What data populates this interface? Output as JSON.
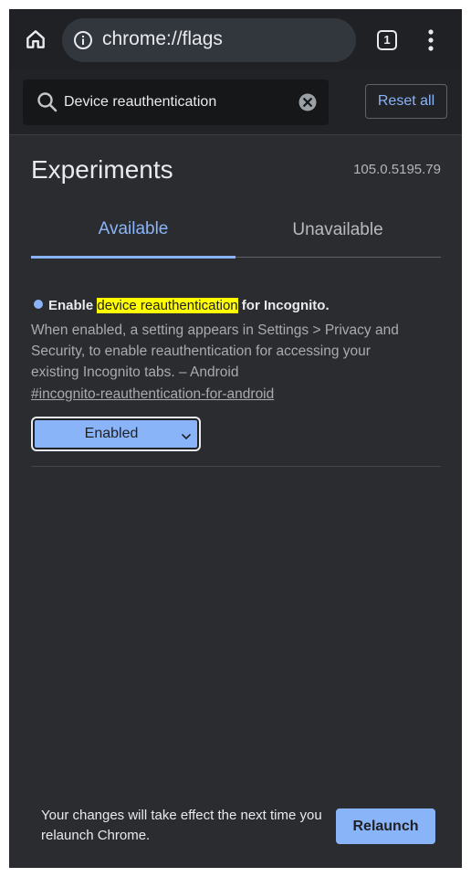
{
  "toolbar": {
    "home_icon": "home-icon",
    "info_icon": "info-icon",
    "url": "chrome://flags",
    "tab_count": "1",
    "menu_icon": "more-vert-icon"
  },
  "search": {
    "query": "Device reauthentication",
    "search_icon": "search-icon",
    "clear_icon": "clear-icon",
    "reset_label": "Reset all"
  },
  "header": {
    "title": "Experiments",
    "version": "105.0.5195.79"
  },
  "tabs": [
    {
      "label": "Available",
      "selected": true
    },
    {
      "label": "Unavailable",
      "selected": false
    }
  ],
  "flag": {
    "title_prefix": "Enable ",
    "title_highlight": "device reauthentication",
    "title_suffix": " for Incognito.",
    "description": "When enabled, a setting appears in Settings > Privacy and Security, to enable reauthentication for accessing your existing Incognito tabs. – Android",
    "link": "#incognito-reauthentication-for-android",
    "selected_value": "Enabled"
  },
  "relaunch": {
    "message": "Your changes will take effect the next time you relaunch Chrome.",
    "button_label": "Relaunch"
  },
  "colors": {
    "accent": "#8ab4f8",
    "background": "#2b2c30",
    "toolbar": "#1f2124",
    "highlight": "#ffff00"
  }
}
